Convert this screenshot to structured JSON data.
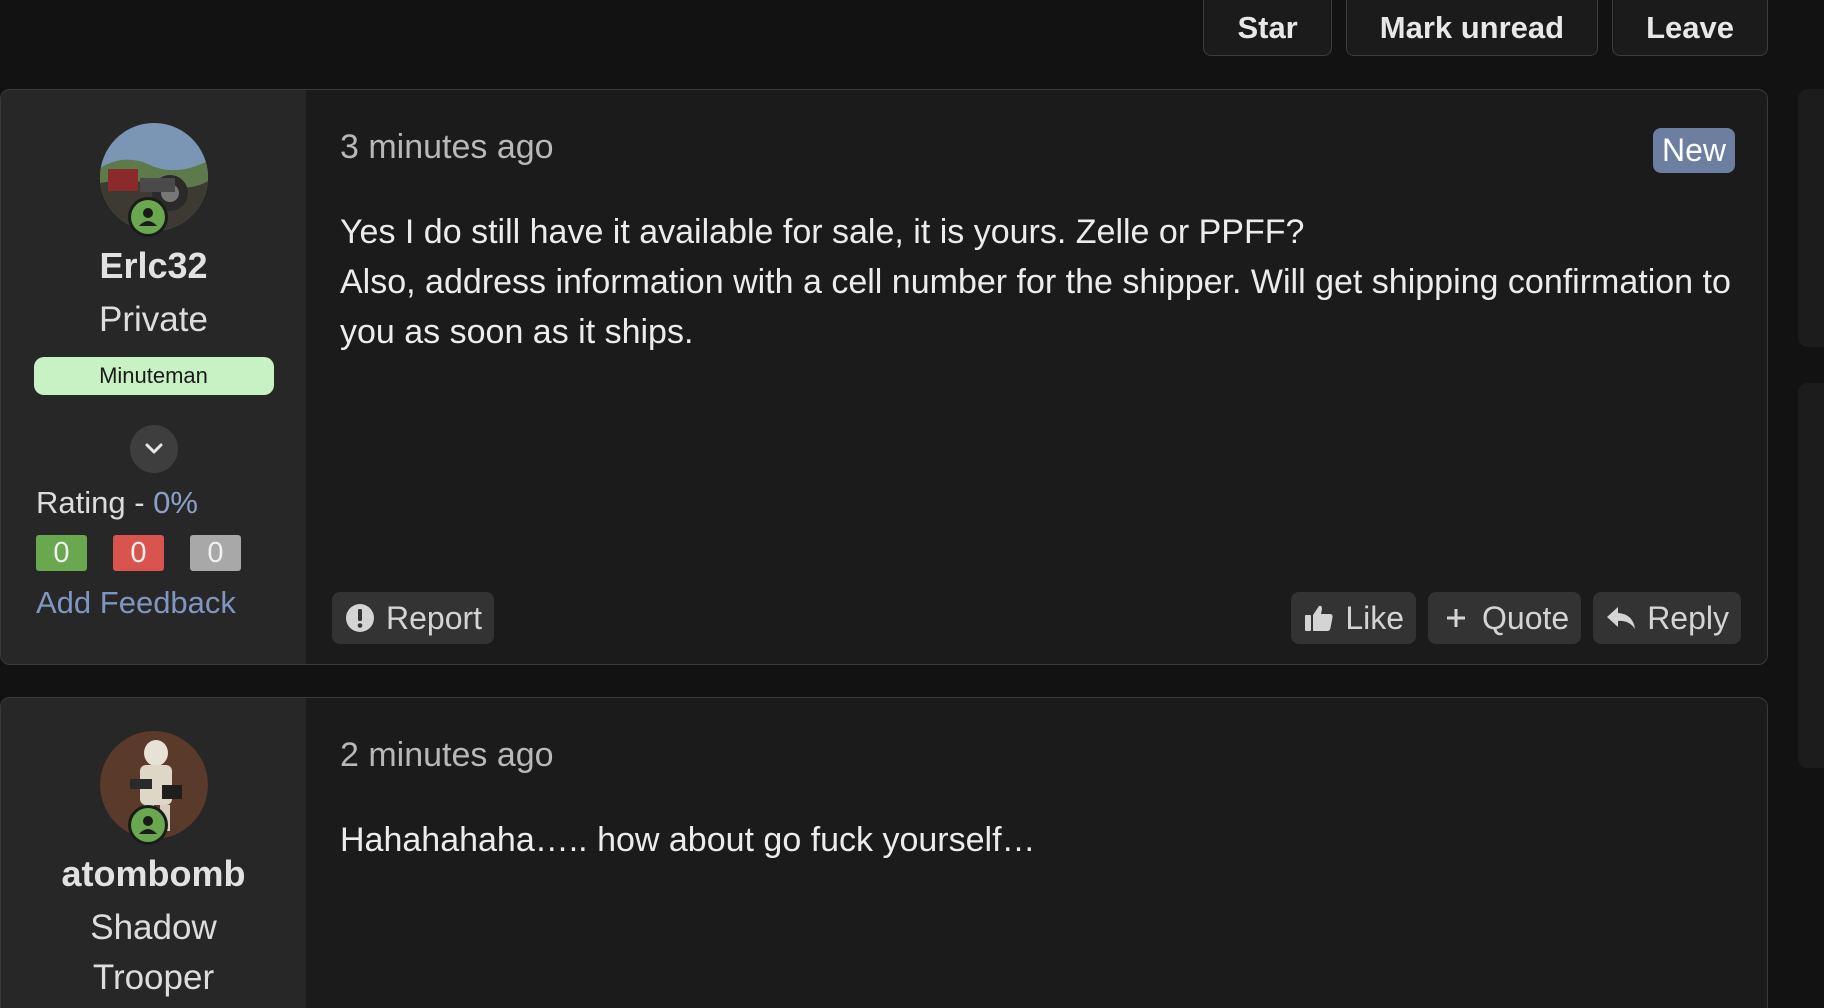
{
  "top_actions": {
    "star": "Star",
    "mark_unread": "Mark unread",
    "leave": "Leave"
  },
  "posts": [
    {
      "username": "Erlc32",
      "title_lines": [
        "Private"
      ],
      "rank": "Minuteman",
      "rating_label": "Rating - ",
      "rating_value": "0%",
      "feedback": {
        "positive": "0",
        "negative": "0",
        "neutral": "0"
      },
      "add_feedback": "Add Feedback",
      "time": "3 minutes ago",
      "badge": "New",
      "body": [
        "Yes I do still have it available for sale, it is yours. Zelle or PPFF?",
        "Also, address information with a cell number for the shipper. Will get shipping confirmation to you as soon as it ships."
      ],
      "actions": {
        "report": "Report",
        "like": "Like",
        "quote": "Quote",
        "reply": "Reply"
      }
    },
    {
      "username": "atombomb",
      "title_lines": [
        "Shadow",
        "Trooper"
      ],
      "time": "2 minutes ago",
      "body": [
        "Hahahahaha….. how about go fuck yourself…"
      ]
    }
  ],
  "colors": {
    "background": "#121212",
    "card": "#1b1b1b",
    "sidebar": "#272727",
    "online": "#6aa84f",
    "link": "#7e96c0",
    "new_badge": "#6c7fa0",
    "rank_badge": "#c9f2c4"
  },
  "icons": [
    "user-online-icon",
    "chevron-down-icon",
    "exclamation-icon",
    "thumbs-up-icon",
    "plus-icon",
    "reply-arrow-icon"
  ]
}
